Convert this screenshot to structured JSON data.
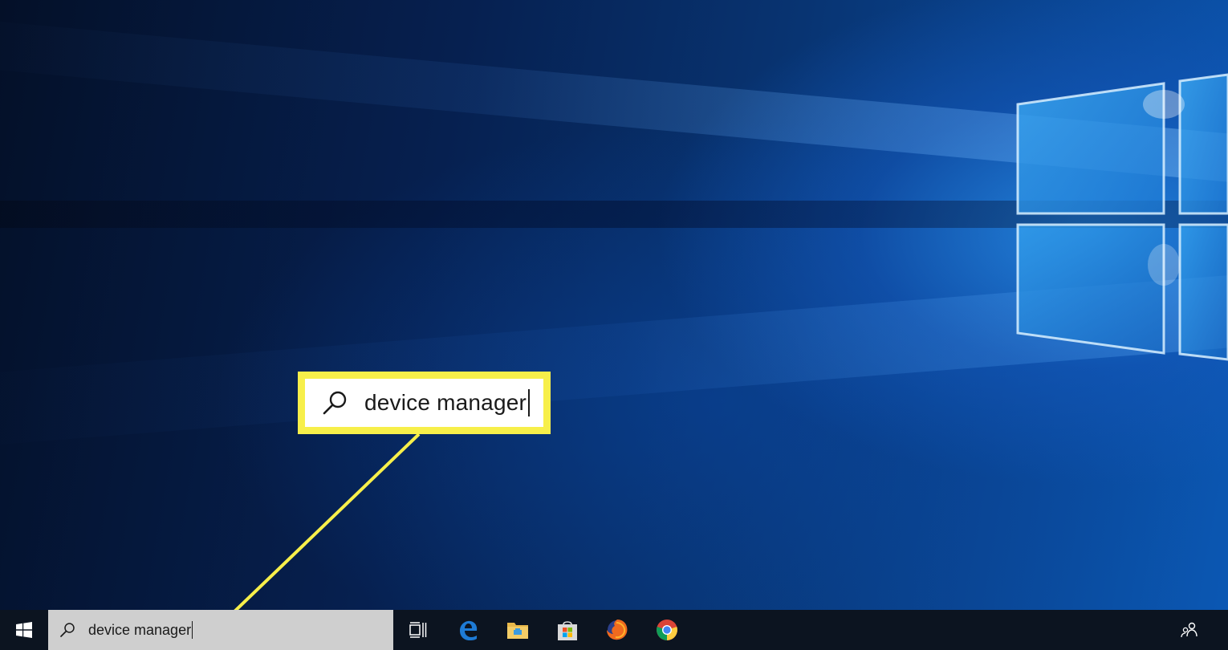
{
  "desktop": {
    "wallpaper": "windows-10-hero",
    "accent": "#0a4a9c"
  },
  "callout": {
    "query": "device manager",
    "icon": "search-icon",
    "highlight_color": "#f7ef4a"
  },
  "taskbar": {
    "start_icon": "windows-logo-icon",
    "search": {
      "value": "device manager",
      "icon": "search-icon"
    },
    "pinned": [
      {
        "name": "task-view-icon"
      },
      {
        "name": "edge-icon"
      },
      {
        "name": "file-explorer-icon"
      },
      {
        "name": "store-icon"
      },
      {
        "name": "firefox-icon"
      },
      {
        "name": "chrome-icon"
      }
    ],
    "tray": {
      "people_icon": "people-icon"
    },
    "background": "#0c1420"
  }
}
